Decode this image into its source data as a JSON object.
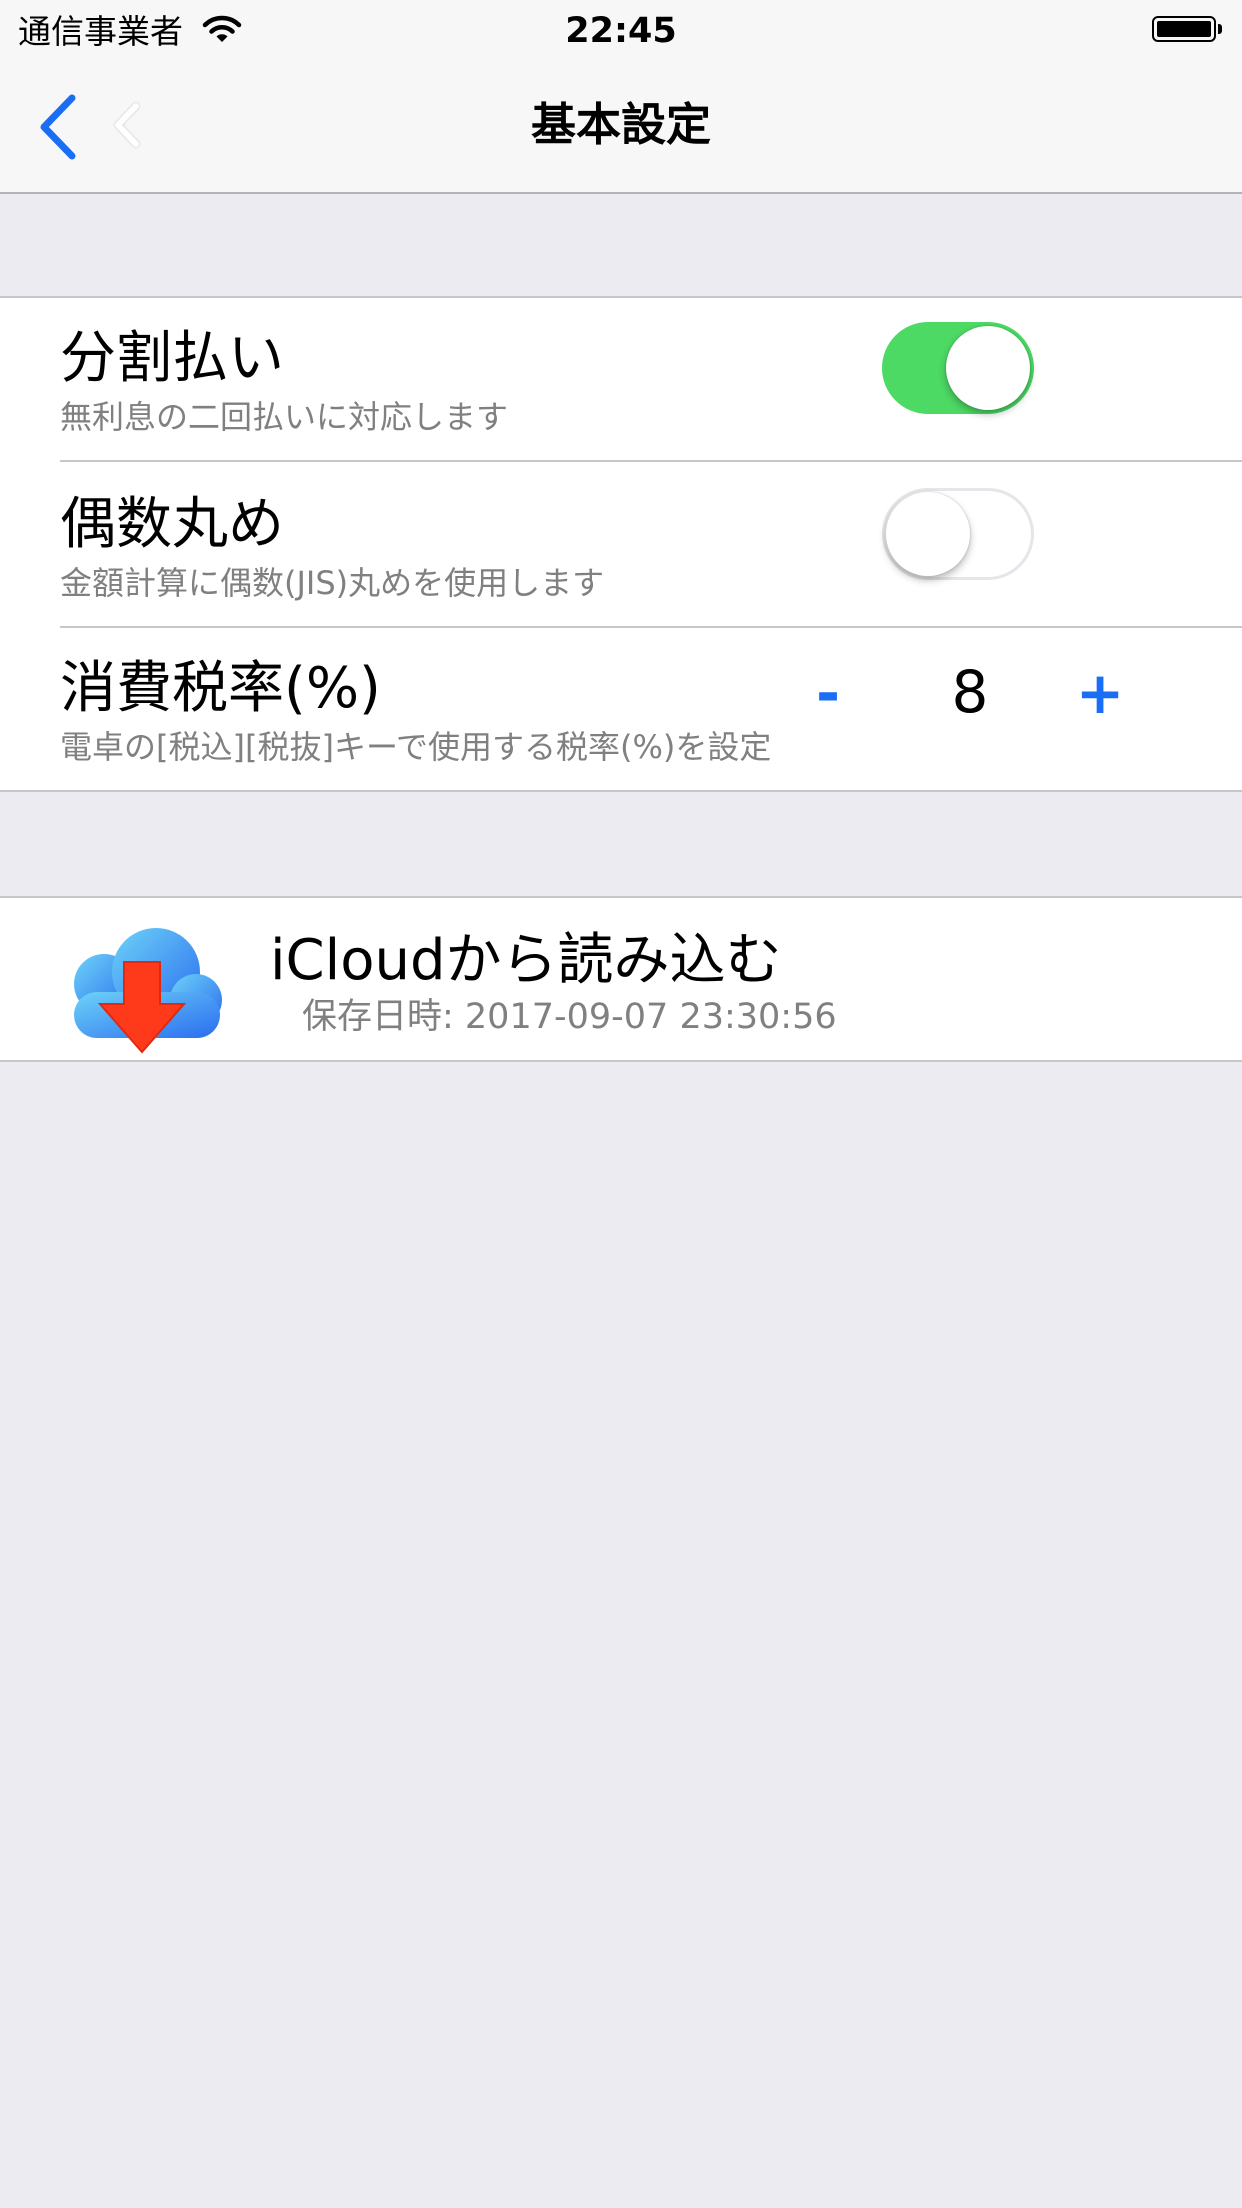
{
  "status_bar": {
    "carrier": "通信事業者",
    "time": "22:45"
  },
  "nav": {
    "title": "基本設定"
  },
  "settings": {
    "installments": {
      "title": "分割払い",
      "subtitle": "無利息の二回払いに対応します",
      "enabled": true
    },
    "even_rounding": {
      "title": "偶数丸め",
      "subtitle": "金額計算に偶数(JIS)丸めを使用します",
      "enabled": false
    },
    "tax_rate": {
      "title": "消費税率(%)",
      "subtitle": "電卓の[税込][税抜]キーで使用する税率(%)を設定",
      "minus_label": "-",
      "value": "8",
      "plus_label": "+"
    }
  },
  "icloud": {
    "title": "iCloudから読み込む",
    "saved_at": "保存日時: 2017-09-07 23:30:56"
  },
  "colors": {
    "accent": "#1a6ef5",
    "switch_on": "#4cd964",
    "background": "#ebebf1"
  }
}
